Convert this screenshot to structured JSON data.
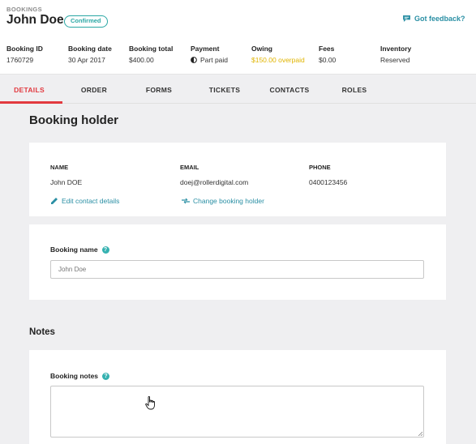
{
  "header": {
    "breadcrumb": "BOOKINGS",
    "title": "John Doe",
    "status_badge": "Confirmed",
    "feedback_link": "Got feedback?",
    "meta": [
      {
        "label": "Booking ID",
        "value": "1760729"
      },
      {
        "label": "Booking date",
        "value": "30 Apr 2017"
      },
      {
        "label": "Booking total",
        "value": "$400.00"
      },
      {
        "label": "Payment",
        "value": "Part paid"
      },
      {
        "label": "Owing",
        "value": "$150.00 overpaid"
      },
      {
        "label": "Fees",
        "value": "$0.00"
      },
      {
        "label": "Inventory",
        "value": "Reserved"
      }
    ]
  },
  "tabs": [
    "DETAILS",
    "ORDER",
    "FORMS",
    "TICKETS",
    "CONTACTS",
    "ROLES"
  ],
  "active_tab": "DETAILS",
  "booking_holder": {
    "heading": "Booking holder",
    "name_label": "NAME",
    "name_value": "John DOE",
    "email_label": "EMAIL",
    "email_value": "doej@rollerdigital.com",
    "phone_label": "PHONE",
    "phone_value": "0400123456",
    "edit_link": "Edit contact details",
    "change_link": "Change booking holder"
  },
  "booking_name": {
    "label": "Booking name",
    "placeholder": "John Doe"
  },
  "notes": {
    "heading": "Notes",
    "label": "Booking notes",
    "value": ""
  },
  "colors": {
    "accent_teal": "#2aa7a4",
    "active_tab_red": "#e2393f",
    "overpaid_yellow": "#e0b400"
  },
  "icons": [
    "feedback-icon",
    "part-paid-icon",
    "edit-icon",
    "swap-icon",
    "help-icon",
    "hand-cursor-icon"
  ]
}
